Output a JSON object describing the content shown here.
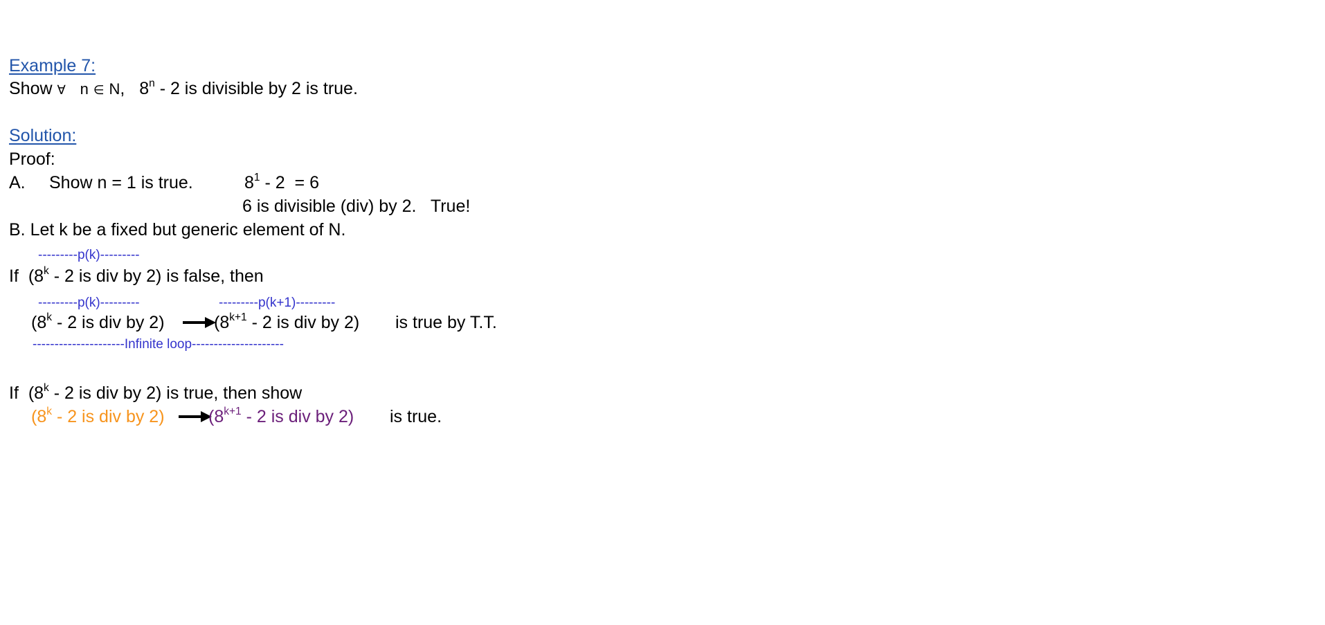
{
  "example": {
    "heading": "Example 7:",
    "statement_show": "Show",
    "forall_symbol": "∀",
    "n_var": "n",
    "in_symbol": "∈",
    "set_n": "N",
    "comma": ",",
    "base": "8",
    "exp_n": "n",
    "statement_rest": "- 2 is divisible by 2 is true."
  },
  "solution": {
    "heading": "Solution:",
    "proof_label": "Proof:",
    "step_a": {
      "label": "A.",
      "text": "Show n = 1 is true.",
      "calc_base": "8",
      "calc_exp": "1",
      "calc_rest": "- 2  = 6",
      "conclusion": "6 is divisible (div) by 2.",
      "verdict": "True!"
    },
    "step_b": {
      "text": "B. Let k be a fixed but generic element of N."
    },
    "false_case": {
      "pk_label": "---------p(k)---------",
      "if_word": "If",
      "open": "(8",
      "exp_k": "k",
      "mid": "- 2 is div by 2) is false, then"
    },
    "implication_row": {
      "pk_label": "---------p(k)---------",
      "pk1_label": "---------p(k+1)---------",
      "left_open": "(8",
      "left_exp": "k",
      "left_rest": "- 2 is div by 2)",
      "right_open": "(8",
      "right_exp": "k+1",
      "right_rest": "- 2 is div by 2)",
      "tail": "is true by T.T.",
      "loop_label": "---------------------Infinite loop---------------------"
    },
    "true_case": {
      "if_word": "If",
      "open": "(8",
      "exp_k": "k",
      "mid": "- 2 is div by 2) is true, then show",
      "left_open": "(8",
      "left_exp": "k",
      "left_rest": "- 2 is div by 2)",
      "right_open": "(8",
      "right_exp": "k+1",
      "right_rest": "- 2 is div by 2)",
      "tail": "is true."
    }
  },
  "colors": {
    "heading": "#2255aa",
    "annotation": "#3333cc",
    "hypothesis": "#f7941d",
    "conclusion": "#6b1f7a",
    "text": "#000000"
  },
  "icons": {
    "arrow": "right-arrow-icon"
  }
}
